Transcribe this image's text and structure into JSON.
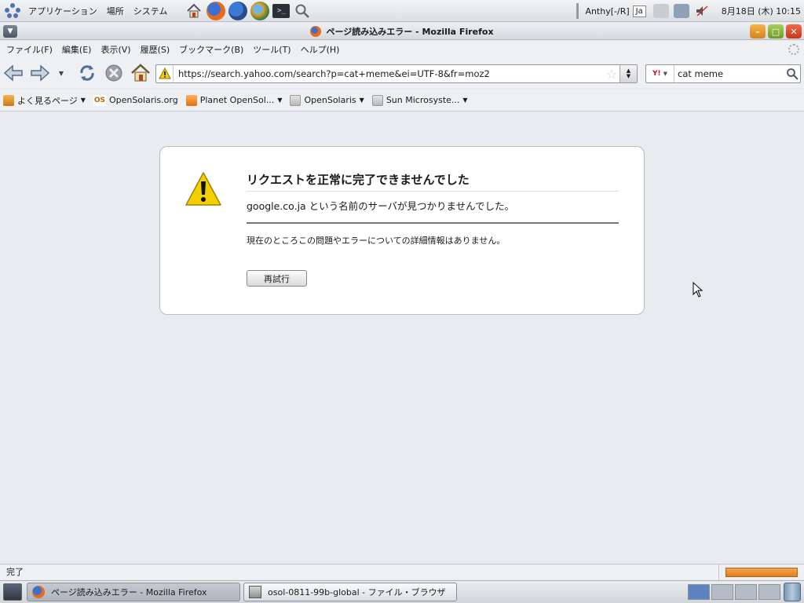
{
  "top_panel": {
    "menus": [
      "アプリケーション",
      "場所",
      "システム"
    ],
    "launchers": [
      "home-launcher-icon",
      "firefox-launcher-icon",
      "thunderbird-launcher-icon",
      "update-launcher-icon",
      "terminal-launcher-icon",
      "search-launcher-icon"
    ],
    "input_method": "Anthy[-/R]",
    "input_lang": "Ja",
    "clock": "8月18日 (木) 10:15"
  },
  "window": {
    "title": "ページ読み込みエラー - Mozilla Firefox",
    "min_label": "–",
    "max_label": "□",
    "close_label": "✕"
  },
  "menubar": {
    "items": [
      "ファイル(F)",
      "編集(E)",
      "表示(V)",
      "履歴(S)",
      "ブックマーク(B)",
      "ツール(T)",
      "ヘルプ(H)"
    ]
  },
  "navbar": {
    "url": "https://search.yahoo.com/search?p=cat+meme&ei=UTF-8&fr=moz2",
    "search_engine": "Y!",
    "search_value": "cat meme"
  },
  "bookmarks": {
    "items": [
      {
        "label": "よく見るページ",
        "dropdown": true
      },
      {
        "label": "OpenSolaris.org",
        "dropdown": false
      },
      {
        "label": "Planet OpenSol...",
        "dropdown": true
      },
      {
        "label": "OpenSolaris",
        "dropdown": true
      },
      {
        "label": "Sun Microsyste...",
        "dropdown": true
      }
    ],
    "os_badge": "OS"
  },
  "error": {
    "title": "リクエストを正常に完了できませんでした",
    "description": "google.co.ja という名前のサーバが見つかりませんでした。",
    "detail": "現在のところこの問題やエラーについての詳細情報はありません。",
    "retry_label": "再試行"
  },
  "status": {
    "text": "完了",
    "progress": 1.0
  },
  "taskbar": {
    "tasks": [
      {
        "label": "ページ読み込みエラー - Mozilla Firefox",
        "active": true
      },
      {
        "label": "osol-0811-99b-global - ファイル・ブラウザ",
        "active": false
      }
    ],
    "workspaces": 4,
    "current_workspace": 1
  },
  "colors": {
    "accent_orange": "#e07d20",
    "warning_yellow": "#f5d000"
  }
}
